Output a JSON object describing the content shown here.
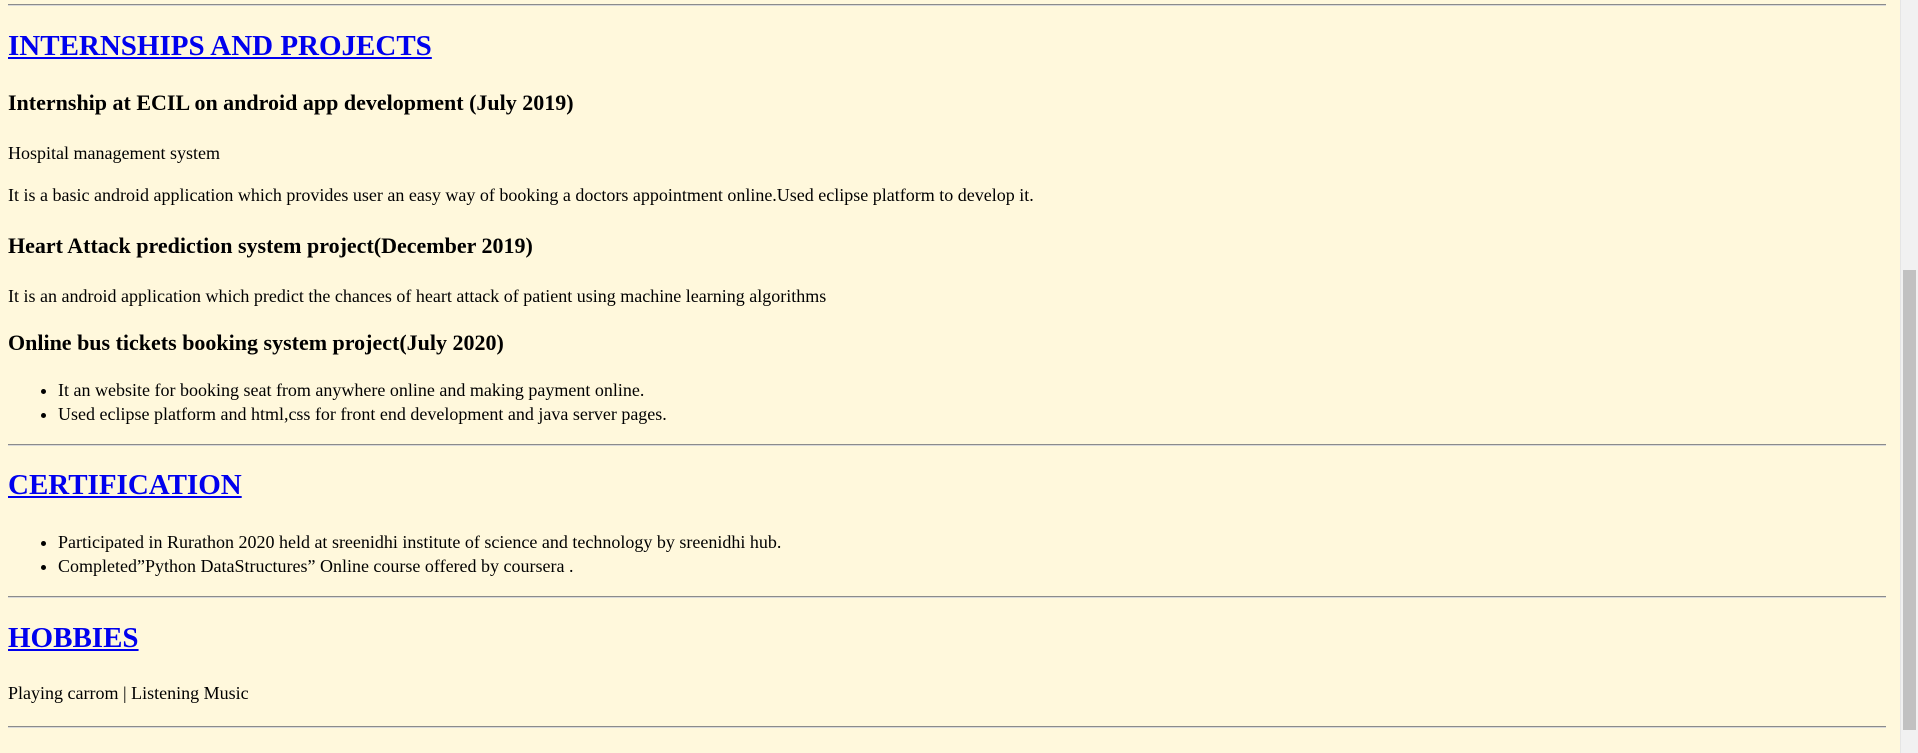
{
  "sections": {
    "internships": {
      "title": "INTERNSHIPS AND PROJECTS",
      "items": [
        {
          "heading": "Internship at ECIL on android app development (July 2019)",
          "subtitle": "Hospital management system",
          "description": "It is a basic android application which provides user an easy way of booking a doctors appointment online.Used eclipse platform to develop it."
        },
        {
          "heading": "Heart Attack prediction system project(December 2019)",
          "description": "It is an android application which predict the chances of heart attack of patient using machine learning algorithms"
        },
        {
          "heading": "Online bus tickets booking system project(July 2020)",
          "bullets": [
            "It an website for booking seat from anywhere online and making payment online.",
            "Used eclipse platform and html,css for front end development and java server pages."
          ]
        }
      ]
    },
    "certification": {
      "title": "CERTIFICATION",
      "bullets": [
        "Participated in Rurathon 2020 held at sreenidhi institute of science and technology by sreenidhi hub.",
        "Completed”Python DataStructures” Online course offered by coursera ."
      ]
    },
    "hobbies": {
      "title": "HOBBIES",
      "text": "Playing carrom | Listening Music"
    }
  },
  "theme": {
    "background": "#fff8dc",
    "link": "#0000ee"
  }
}
